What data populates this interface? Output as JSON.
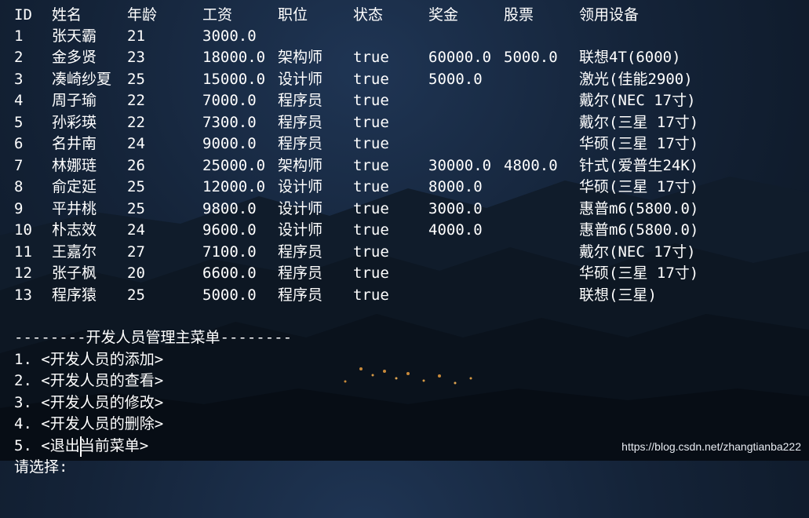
{
  "table": {
    "headers": [
      "ID",
      "姓名",
      "年龄",
      "工资",
      "职位",
      "状态",
      "奖金",
      "股票",
      "领用设备"
    ],
    "rows": [
      [
        "1",
        "张天霸",
        "21",
        "3000.0",
        "",
        "",
        "",
        "",
        ""
      ],
      [
        "2",
        "金多贤",
        "23",
        "18000.0",
        "架构师",
        "true",
        "60000.0",
        "5000.0",
        "联想4T(6000)"
      ],
      [
        "3",
        "凑崎纱夏",
        "25",
        "15000.0",
        "设计师",
        "true",
        "5000.0",
        "",
        "激光(佳能2900)"
      ],
      [
        "4",
        "周子瑜",
        "22",
        "7000.0",
        "程序员",
        "true",
        "",
        "",
        "戴尔(NEC 17寸)"
      ],
      [
        "5",
        "孙彩瑛",
        "22",
        "7300.0",
        "程序员",
        "true",
        "",
        "",
        "戴尔(三星 17寸)"
      ],
      [
        "6",
        "名井南",
        "24",
        "9000.0",
        "程序员",
        "true",
        "",
        "",
        "华硕(三星 17寸)"
      ],
      [
        "7",
        "林娜琏",
        "26",
        "25000.0",
        "架构师",
        "true",
        "30000.0",
        "4800.0",
        "针式(爱普生24K)"
      ],
      [
        "8",
        "俞定延",
        "25",
        "12000.0",
        "设计师",
        "true",
        "8000.0",
        "",
        "华硕(三星 17寸)"
      ],
      [
        "9",
        "平井桃",
        "25",
        "9800.0",
        "设计师",
        "true",
        "3000.0",
        "",
        "惠普m6(5800.0)"
      ],
      [
        "10",
        "朴志效",
        "24",
        "9600.0",
        "设计师",
        "true",
        "4000.0",
        "",
        "惠普m6(5800.0)"
      ],
      [
        "11",
        "王嘉尔",
        "27",
        "7100.0",
        "程序员",
        "true",
        "",
        "",
        "戴尔(NEC 17寸)"
      ],
      [
        "12",
        "张子枫",
        "20",
        "6600.0",
        "程序员",
        "true",
        "",
        "",
        "华硕(三星 17寸)"
      ],
      [
        "13",
        "程序猿",
        "25",
        "5000.0",
        "程序员",
        "true",
        "",
        "",
        "联想(三星)"
      ]
    ]
  },
  "menu": {
    "title": "--------开发人员管理主菜单--------",
    "options": [
      "1. <开发人员的添加>",
      "2. <开发人员的查看>",
      "3. <开发人员的修改>",
      "4. <开发人员的删除>",
      "5. <退出当前菜单>"
    ],
    "prompt": "请选择:"
  },
  "watermark": "https://blog.csdn.net/zhangtianba222"
}
